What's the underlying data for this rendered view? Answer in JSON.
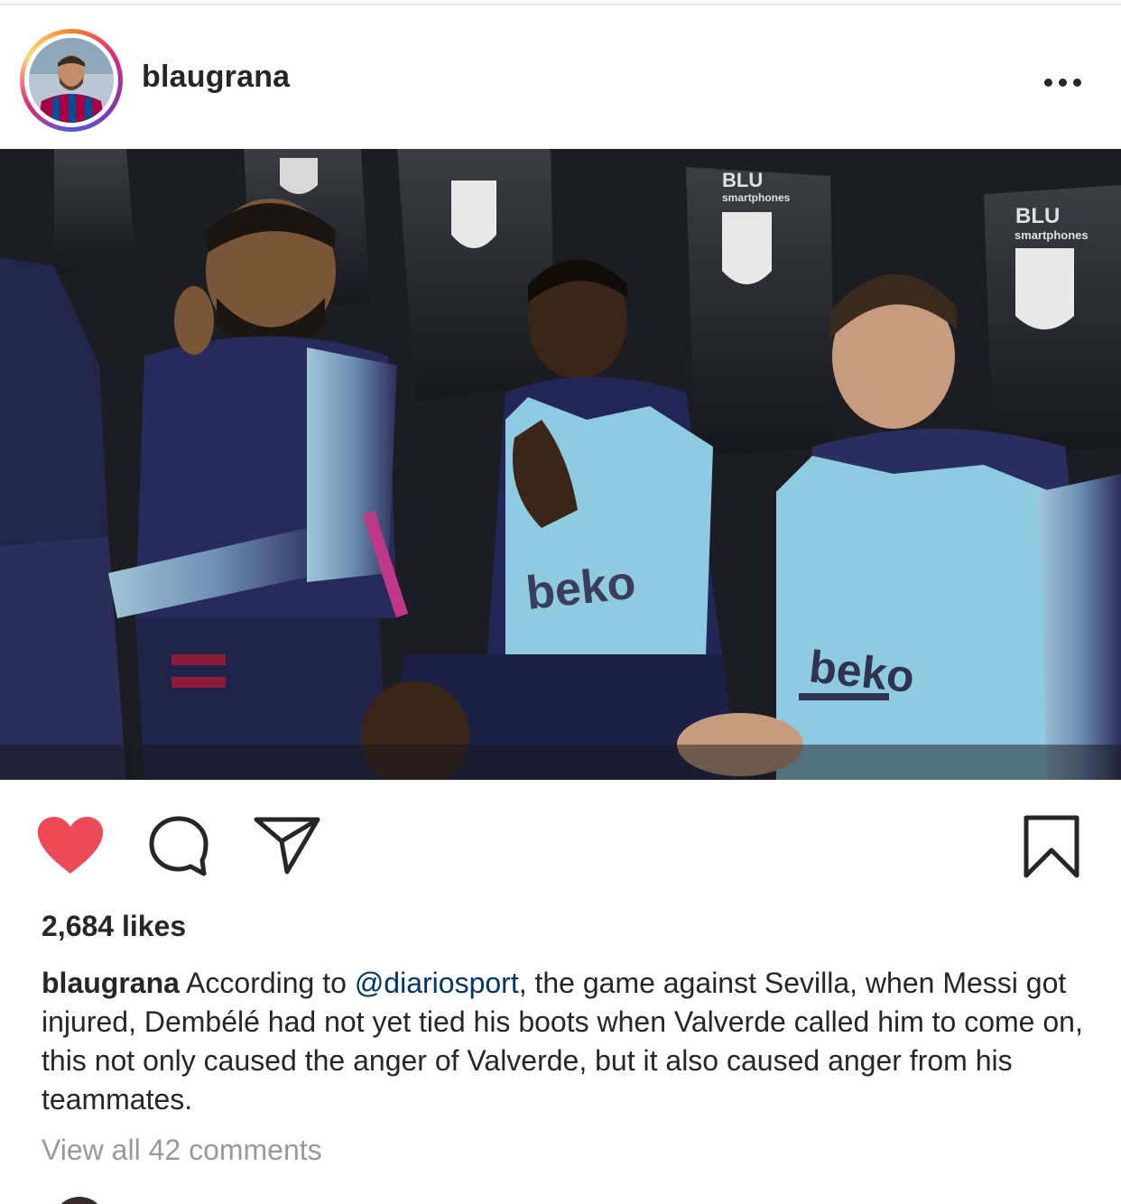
{
  "post": {
    "username": "blaugrana",
    "avatar_icon": "profile-photo-avatar",
    "more_icon": "more-options-icon"
  },
  "actions": {
    "like_icon": "heart-filled-icon",
    "like_color": "#ed4956",
    "comment_icon": "comment-bubble-icon",
    "share_icon": "send-icon",
    "save_icon": "bookmark-icon"
  },
  "likes": {
    "text": "2,684 likes"
  },
  "caption": {
    "username": "blaugrana",
    "text_before_mention": " According to ",
    "mention": "@diariosport",
    "text_after_mention": ", the game against Sevilla, when Messi got injured, Dembélé had not yet tied his boots when Valverde called him to come on, this not only caused the anger of Valverde, but it also caused anger from his teammates.",
    "mention_color": "#003569"
  },
  "comments": {
    "view_all": "View all 42 comments"
  },
  "photo": {
    "seat_sponsor_line1": "BLU",
    "seat_sponsor_line2": "smartphones",
    "bib_sponsor": "beko"
  }
}
